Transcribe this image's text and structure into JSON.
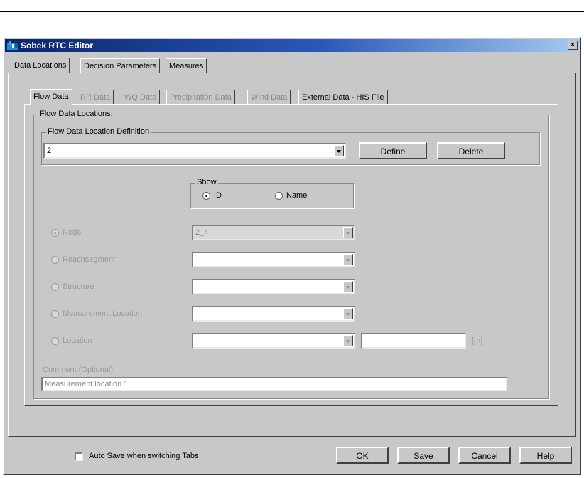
{
  "window": {
    "title": "Sobek RTC Editor",
    "close_glyph": "×"
  },
  "top_tabs": [
    {
      "label": "Data Locations"
    },
    {
      "label": "Decision Parameters"
    },
    {
      "label": "Measures"
    }
  ],
  "sub_tabs": [
    {
      "label": "Flow Data",
      "enabled": true
    },
    {
      "label": "RR Data",
      "enabled": false
    },
    {
      "label": "WQ Data",
      "enabled": false
    },
    {
      "label": "Precipitation Data",
      "enabled": false
    },
    {
      "label": "Wind Data",
      "enabled": false
    },
    {
      "label": "External Data - HIS File",
      "enabled": true
    }
  ],
  "flow_data_locations": {
    "group_label": "Flow Data Locations:",
    "definition": {
      "group_label": "Flow Data Location Definition",
      "selected_value": "2",
      "define_label": "Define",
      "delete_label": "Delete"
    },
    "show": {
      "group_label": "Show",
      "options": [
        "ID",
        "Name"
      ],
      "selected": "ID"
    },
    "location_types": [
      {
        "label": "Node",
        "value": "2_4",
        "selected": true
      },
      {
        "label": "Reachsegment",
        "value": "",
        "selected": false
      },
      {
        "label": "Structure",
        "value": "",
        "selected": false
      },
      {
        "label": "Measurement Location",
        "value": "",
        "selected": false
      },
      {
        "label": "Location",
        "value": "",
        "selected": false
      }
    ],
    "location_offset": {
      "value": "",
      "unit": "[m]"
    },
    "comment": {
      "label": "Comment (Optional):",
      "value": "Measurement location 1"
    }
  },
  "footer": {
    "auto_save_label": "Auto Save when switching Tabs",
    "auto_save_checked": false,
    "ok_label": "OK",
    "save_label": "Save",
    "cancel_label": "Cancel",
    "help_label": "Help"
  },
  "colors": {
    "dialog_bg": "#c8c8c8",
    "titlebar": "#0a246a",
    "disabled_text": "#9a9a9a"
  }
}
